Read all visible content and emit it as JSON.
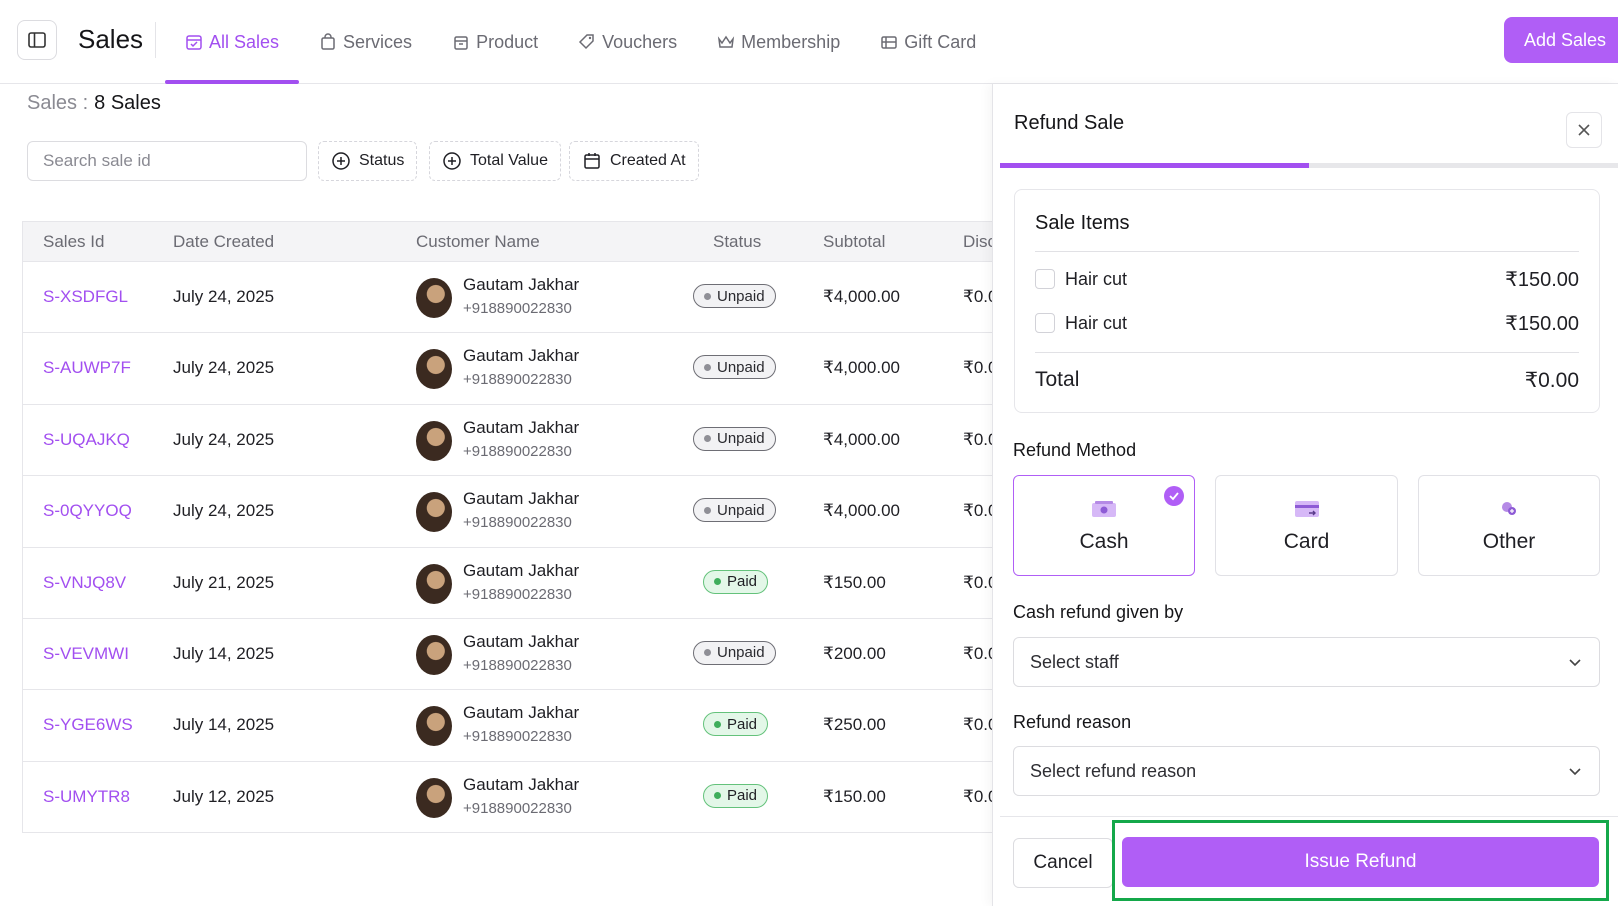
{
  "header": {
    "title": "Sales",
    "tabs": [
      {
        "label": "All Sales",
        "icon": "calendar-check-icon",
        "active": true
      },
      {
        "label": "Services",
        "icon": "bag-icon"
      },
      {
        "label": "Product",
        "icon": "box-icon"
      },
      {
        "label": "Vouchers",
        "icon": "tag-icon"
      },
      {
        "label": "Membership",
        "icon": "crown-icon"
      },
      {
        "label": "Gift Card",
        "icon": "gift-card-icon"
      }
    ],
    "add_button": "Add Sales"
  },
  "summary": {
    "label": "Sales :",
    "count": "8 Sales"
  },
  "filters": {
    "search_placeholder": "Search sale id",
    "status": "Status",
    "total_value": "Total Value",
    "created_at": "Created At"
  },
  "table": {
    "columns": [
      "Sales Id",
      "Date Created",
      "Customer Name",
      "Status",
      "Subtotal",
      "Disc"
    ],
    "rows": [
      {
        "id": "S-XSDFGL",
        "date": "July 24, 2025",
        "name": "Gautam Jakhar",
        "phone": "+918890022830",
        "status": "Unpaid",
        "subtotal": "₹4,000.00",
        "disc": "₹0.0"
      },
      {
        "id": "S-AUWP7F",
        "date": "July 24, 2025",
        "name": "Gautam Jakhar",
        "phone": "+918890022830",
        "status": "Unpaid",
        "subtotal": "₹4,000.00",
        "disc": "₹0.0"
      },
      {
        "id": "S-UQAJKQ",
        "date": "July 24, 2025",
        "name": "Gautam Jakhar",
        "phone": "+918890022830",
        "status": "Unpaid",
        "subtotal": "₹4,000.00",
        "disc": "₹0.0"
      },
      {
        "id": "S-0QYYOQ",
        "date": "July 24, 2025",
        "name": "Gautam Jakhar",
        "phone": "+918890022830",
        "status": "Unpaid",
        "subtotal": "₹4,000.00",
        "disc": "₹0.0"
      },
      {
        "id": "S-VNJQ8V",
        "date": "July 21, 2025",
        "name": "Gautam Jakhar",
        "phone": "+918890022830",
        "status": "Paid",
        "subtotal": "₹150.00",
        "disc": "₹0.0"
      },
      {
        "id": "S-VEVMWI",
        "date": "July 14, 2025",
        "name": "Gautam Jakhar",
        "phone": "+918890022830",
        "status": "Unpaid",
        "subtotal": "₹200.00",
        "disc": "₹0.0"
      },
      {
        "id": "S-YGE6WS",
        "date": "July 14, 2025",
        "name": "Gautam Jakhar",
        "phone": "+918890022830",
        "status": "Paid",
        "subtotal": "₹250.00",
        "disc": "₹0.0"
      },
      {
        "id": "S-UMYTR8",
        "date": "July 12, 2025",
        "name": "Gautam Jakhar",
        "phone": "+918890022830",
        "status": "Paid",
        "subtotal": "₹150.00",
        "disc": "₹0.0"
      }
    ]
  },
  "refund": {
    "title": "Refund Sale",
    "progress_fraction": 0.5,
    "items_header": "Sale Items",
    "items": [
      {
        "name": "Hair cut",
        "price": "₹150.00",
        "checked": false
      },
      {
        "name": "Hair cut",
        "price": "₹150.00",
        "checked": false
      }
    ],
    "total_label": "Total",
    "total_value": "₹0.00",
    "method_label": "Refund Method",
    "methods": [
      {
        "label": "Cash",
        "icon": "cash-icon",
        "selected": true
      },
      {
        "label": "Card",
        "icon": "card-icon",
        "selected": false
      },
      {
        "label": "Other",
        "icon": "other-payment-icon",
        "selected": false
      }
    ],
    "staff_label": "Cash refund given by",
    "staff_placeholder": "Select staff",
    "reason_label": "Refund reason",
    "reason_placeholder": "Select refund reason",
    "cancel": "Cancel",
    "issue": "Issue Refund"
  },
  "colors": {
    "accent": "#b05ef6",
    "link": "#a24ff0",
    "highlight": "#14a84a"
  }
}
